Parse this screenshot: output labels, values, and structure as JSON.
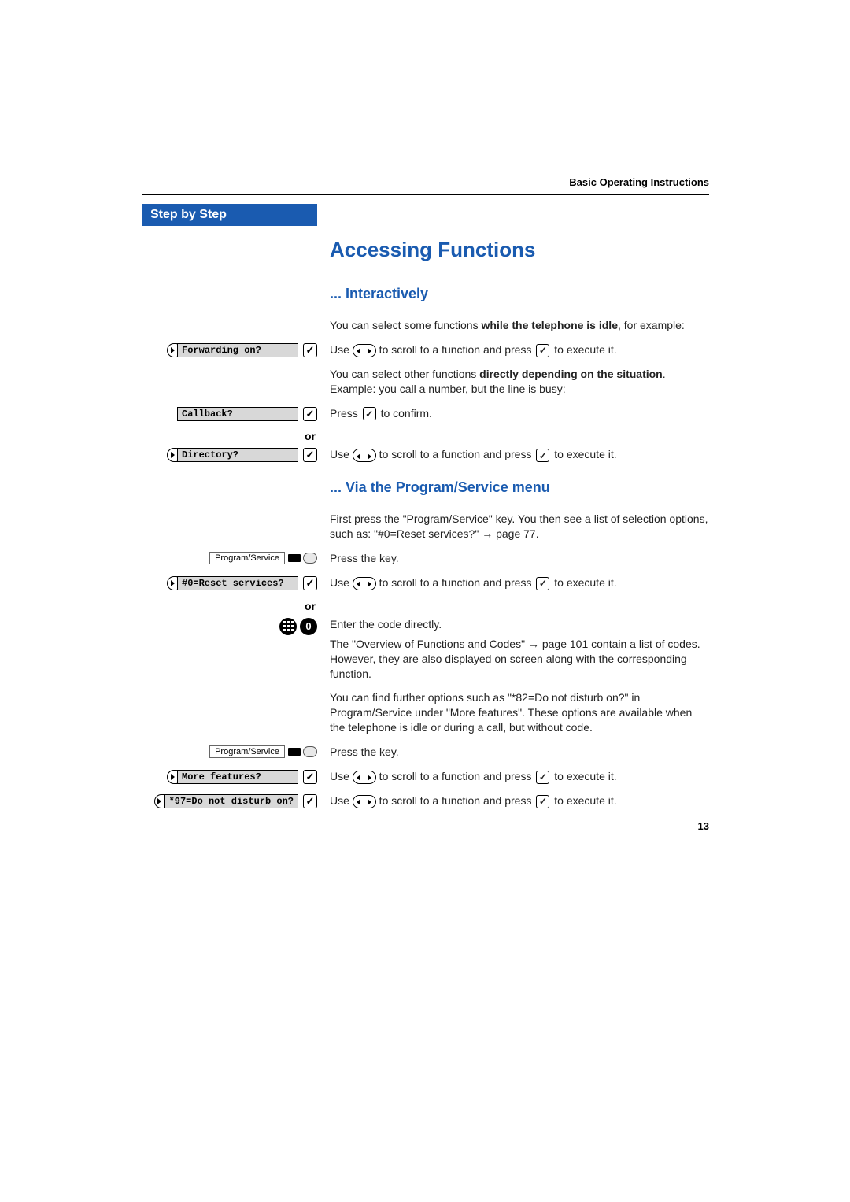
{
  "header": {
    "section_title": "Basic Operating Instructions"
  },
  "sidebar": {
    "title": "Step by Step"
  },
  "headings": {
    "main": "Accessing Functions",
    "sub_interactive": "... Interactively",
    "sub_program": "... Via the Program/Service menu"
  },
  "displays": {
    "forwarding": "Forwarding on?",
    "callback": "Callback?",
    "directory": "Directory?",
    "reset": "#0=Reset services?",
    "more": "More features?",
    "dnd": "*97=Do not disturb on?"
  },
  "keys": {
    "program_service": "Program/Service",
    "code_hash": "#",
    "code_zero": "0"
  },
  "text": {
    "or": "or",
    "idle_intro_1": "You can select some functions ",
    "idle_intro_bold": "while the telephone is idle",
    "idle_intro_2": ", for example:",
    "use_scroll_1": "Use ",
    "use_scroll_2": " to scroll to a function and press ",
    "use_scroll_3": " to execute it.",
    "depends_1": "You can select other functions ",
    "depends_bold": "directly depending on the situation",
    "depends_2": ". Example:  you call a number, but the line is busy:",
    "press_confirm_1": "Press ",
    "press_confirm_2": " to confirm.",
    "program_intro_1": "First press the \"Program/Service\" key. You then see a list of selection options, such as: \"#0=Reset services?\" ",
    "program_intro_2": " page 77.",
    "press_key": "Press the key.",
    "enter_code_1": "Enter the code directly.",
    "enter_code_2a": "The \"Overview of Functions and Codes\" ",
    "enter_code_2b": " page 101 contain a list of codes. However, they are also displayed on screen along with the corresponding function.",
    "further": "You can find further options such as \"*82=Do not disturb on?\" in Program/Service under \"More features\". These options are available when the telephone is idle or during a call, but without code."
  },
  "page_number": "13"
}
